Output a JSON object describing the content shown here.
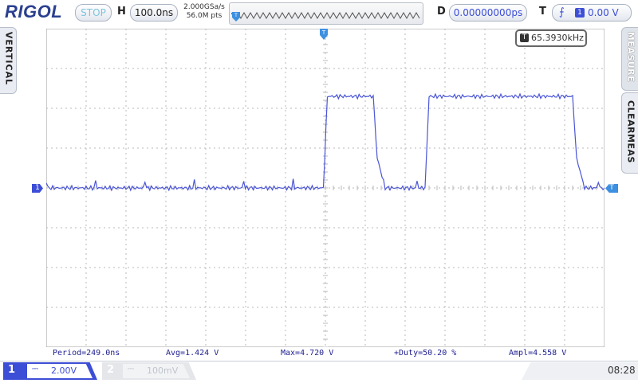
{
  "header": {
    "brand": "RIGOL",
    "run_state": "STOP",
    "timebase_letter": "H",
    "timebase": "100.0ns",
    "sample_rate": "2.000GSa/s",
    "memory_depth": "56.0M pts",
    "delay_letter": "D",
    "delay": "0.00000000ps",
    "trigger_letter": "T",
    "trigger_slope_icon": "rising-edge-icon",
    "trigger_source": "1",
    "trigger_level": "0.00 V"
  },
  "side_tabs": {
    "left": "VERTICAL",
    "right_top": "MEASURE",
    "right_bottom": "CLEARMEAS"
  },
  "frequency_counter": {
    "badge": "T",
    "value": "65.3930kHz"
  },
  "markers": {
    "ch1_label": "1",
    "trigger_level_label": "T"
  },
  "measurements": [
    {
      "label": "Period=249.0ns"
    },
    {
      "label": "Avg=1.424 V"
    },
    {
      "label": "Max=4.720 V"
    },
    {
      "label": "+Duty=50.20 %"
    },
    {
      "label": "Ampl=4.558 V"
    }
  ],
  "channels": [
    {
      "number": "1",
      "coupling_icon": "dc-coupling-icon",
      "coupling_glyph": "⎓",
      "scale": "2.00V",
      "active": true
    },
    {
      "number": "2",
      "coupling_icon": "dc-coupling-icon",
      "coupling_glyph": "⎓",
      "scale": "100mV",
      "active": false
    }
  ],
  "clock": "08:28",
  "colors": {
    "trace": "#4a55d6",
    "accent": "#3d4ed6",
    "grid": "#b9b9b9"
  },
  "chart_data": {
    "type": "line",
    "title": "",
    "xlabel": "",
    "ylabel": "",
    "x_unit": "div",
    "y_unit": "V",
    "xlim": [
      -7,
      7
    ],
    "ylim": [
      -8,
      8
    ],
    "grid": true,
    "series": [
      {
        "x": [
          -7,
          -0.05,
          0.05,
          1.2,
          1.3,
          1.5,
          2.5,
          2.6,
          6.2,
          6.3,
          6.5,
          7
        ],
        "y": [
          0,
          0,
          4.6,
          4.6,
          1.5,
          0,
          0,
          4.6,
          4.6,
          1.5,
          0,
          0
        ]
      }
    ]
  }
}
